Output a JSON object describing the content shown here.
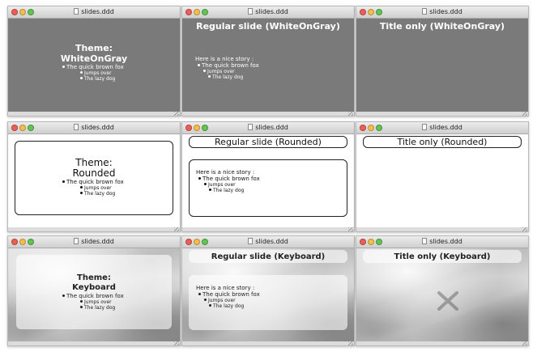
{
  "window_title": "slides.ddd",
  "bullets": {
    "line1": "The quick brown fox",
    "line2": "Jumps over",
    "line3": "The lazy dog"
  },
  "story_intro": "Here is a nice story :",
  "themes": {
    "whiteongray": {
      "title_line1": "Theme:",
      "title_line2": "WhiteOnGray",
      "regular": "Regular slide (WhiteOnGray)",
      "titleonly": "Title only (WhiteOnGray)"
    },
    "rounded": {
      "title_line1": "Theme:",
      "title_line2": "Rounded",
      "regular": "Regular slide (Rounded)",
      "titleonly": "Title only (Rounded)"
    },
    "keyboard": {
      "title_line1": "Theme:",
      "title_line2": "Keyboard",
      "regular": "Regular slide (Keyboard)",
      "titleonly": "Title only (Keyboard)"
    }
  },
  "colors": {
    "gray_bg": "#7a7a7a",
    "close": "#ec5f57",
    "minimize": "#f4be4f",
    "zoom": "#61c454"
  }
}
